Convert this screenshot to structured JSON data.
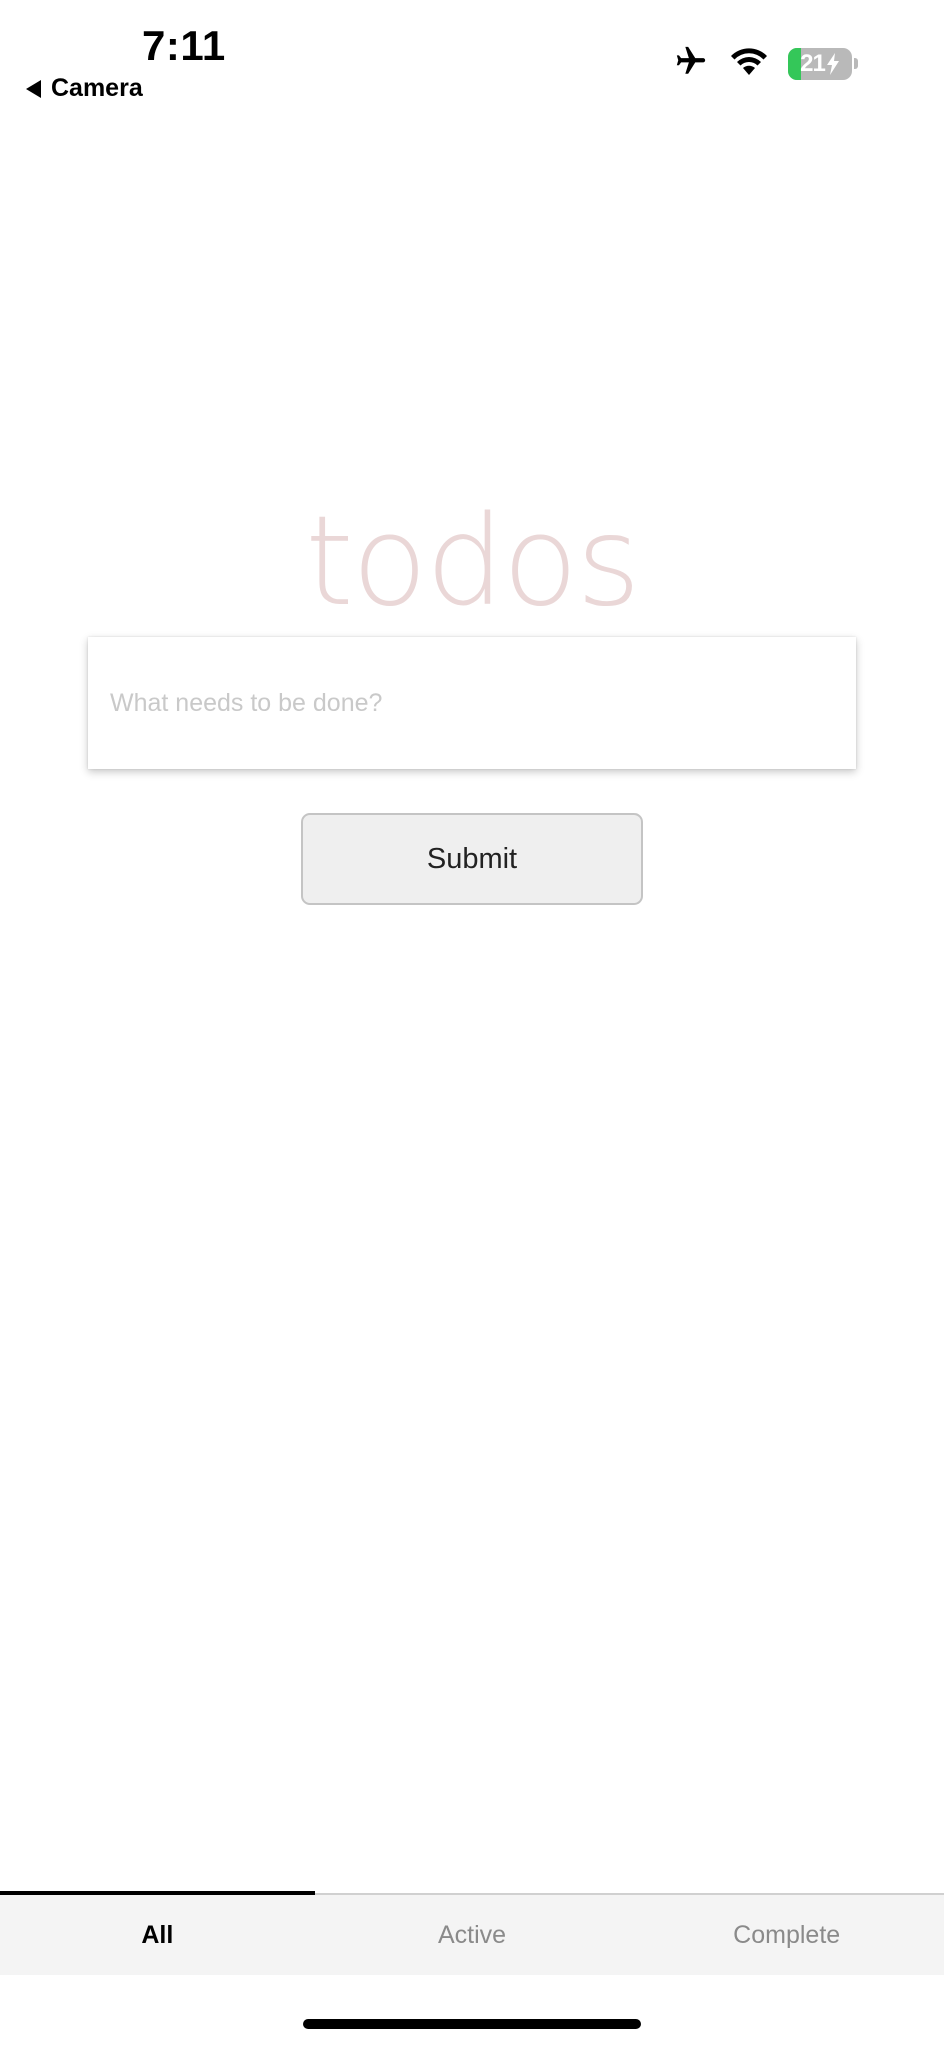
{
  "status_bar": {
    "time": "7:11",
    "back_label": "Camera",
    "battery_level": "21",
    "battery_fraction": 0.21,
    "battery_color": "#34c759",
    "icons": [
      "airplane-mode-icon",
      "wifi-icon",
      "battery-charging-icon"
    ]
  },
  "header": {
    "title": "todos",
    "title_color": "#ead7d7"
  },
  "new_todo": {
    "placeholder": "What needs to be done?",
    "value": ""
  },
  "submit": {
    "label": "Submit"
  },
  "filters": {
    "tabs": [
      {
        "label": "All",
        "active": true
      },
      {
        "label": "Active",
        "active": false
      },
      {
        "label": "Complete",
        "active": false
      }
    ]
  }
}
